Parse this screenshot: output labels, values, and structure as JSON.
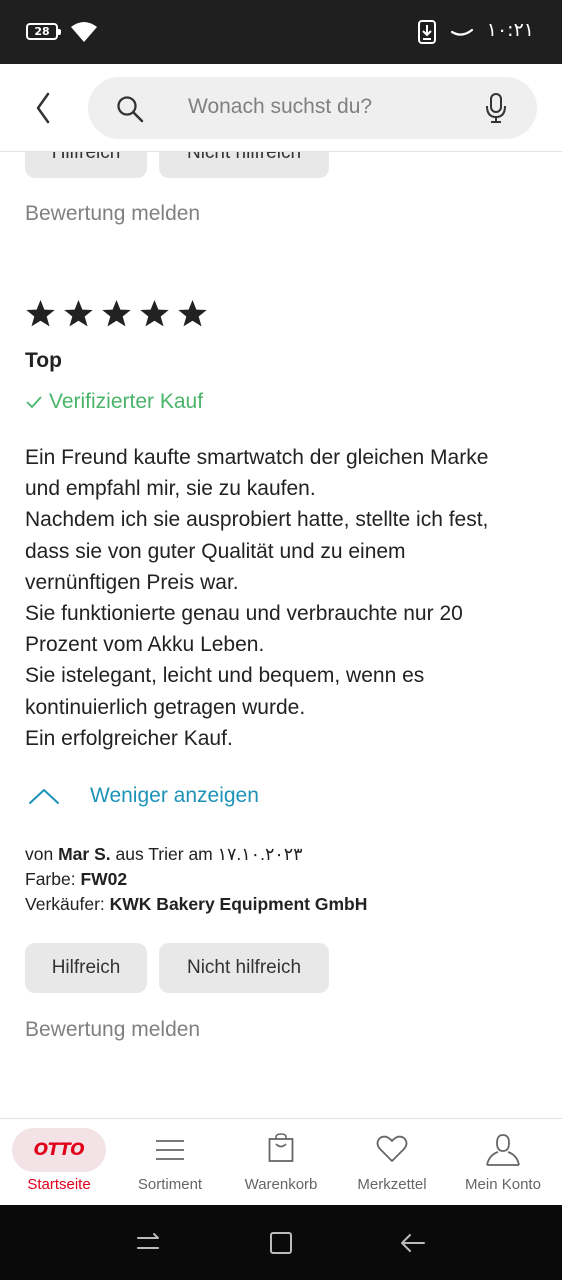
{
  "status_bar": {
    "battery": "28",
    "time": "١٠:٢١",
    "icons": [
      "battery-icon",
      "wifi-icon",
      "download-icon",
      "signal-icon"
    ]
  },
  "header": {
    "search_placeholder": "Wonach suchst du?",
    "icons": [
      "back-arrow-icon",
      "search-icon",
      "microphone-icon"
    ]
  },
  "previous_review": {
    "helpful_label": "Hilfreich",
    "not_helpful_label": "Nicht hilfreich",
    "report_label": "Bewertung melden"
  },
  "review": {
    "rating": 5,
    "rating_max": 5,
    "title": "Top",
    "verified_label": "Verifizierter Kauf",
    "text_lines": [
      "Ein Freund kaufte smartwatch der gleichen Marke",
      "und empfahl mir, sie zu kaufen.",
      "Nachdem ich sie ausprobiert hatte, stellte ich fest,",
      "dass sie von guter Qualität und zu einem",
      "vernünftigen Preis war.",
      "Sie funktionierte genau und verbrauchte nur 20",
      "Prozent vom Akku Leben.",
      "Sie istelegant, leicht und bequem, wenn es",
      "kontinuierlich getragen wurde.",
      "Ein erfolgreicher Kauf."
    ],
    "show_less_label": "Weniger anzeigen",
    "author_prefix": "von",
    "author": "Mar S.",
    "location_text": "aus Trier am",
    "date": "١٧.١٠.٢٠٢٣",
    "color_label": "Farbe:",
    "color_value": "FW02",
    "seller_label": "Verkäufer:",
    "seller_value": "KWK Bakery Equipment GmbH",
    "helpful_label": "Hilfreich",
    "not_helpful_label": "Nicht hilfreich",
    "report_label": "Bewertung melden"
  },
  "bottom_nav": {
    "items": [
      {
        "label": "Startseite",
        "icon": "otto-logo",
        "logo_text": "OTTO",
        "active": true
      },
      {
        "label": "Sortiment",
        "icon": "menu-lines-icon",
        "active": false
      },
      {
        "label": "Warenkorb",
        "icon": "shopping-bag-icon",
        "active": false
      },
      {
        "label": "Merkzettel",
        "icon": "heart-icon",
        "active": false
      },
      {
        "label": "Mein Konto",
        "icon": "user-icon",
        "active": false
      }
    ]
  },
  "colors": {
    "accent_red": "#e1001a",
    "verified_green": "#4ab56a",
    "link_blue": "#1d93b8",
    "status_bar_bg": "#1f1f1f"
  }
}
